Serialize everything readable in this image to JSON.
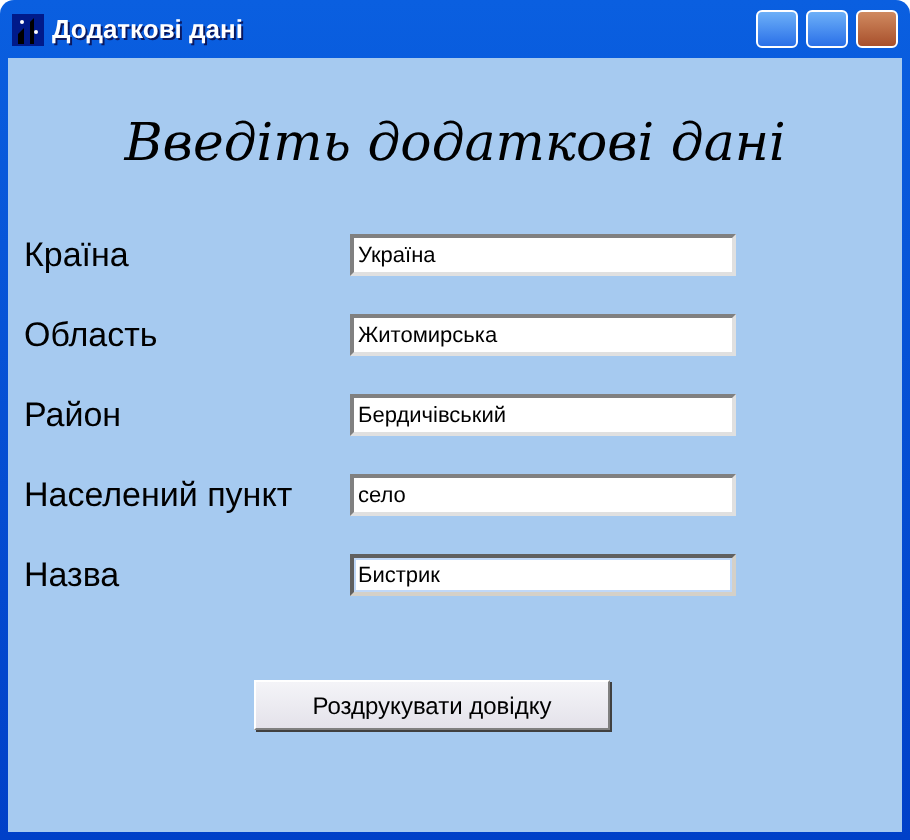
{
  "window": {
    "title": "Додаткові дані"
  },
  "heading": "Введіть додаткові дані",
  "fields": [
    {
      "label": "Країна",
      "value": "Україна",
      "focused": false
    },
    {
      "label": "Область",
      "value": "Житомирська",
      "focused": false
    },
    {
      "label": "Район",
      "value": "Бердичівський",
      "focused": false
    },
    {
      "label": "Населений пункт",
      "value": "село",
      "focused": false
    },
    {
      "label": "Назва",
      "value": "Бистрик",
      "focused": true
    }
  ],
  "button": "Роздрукувати довідку"
}
